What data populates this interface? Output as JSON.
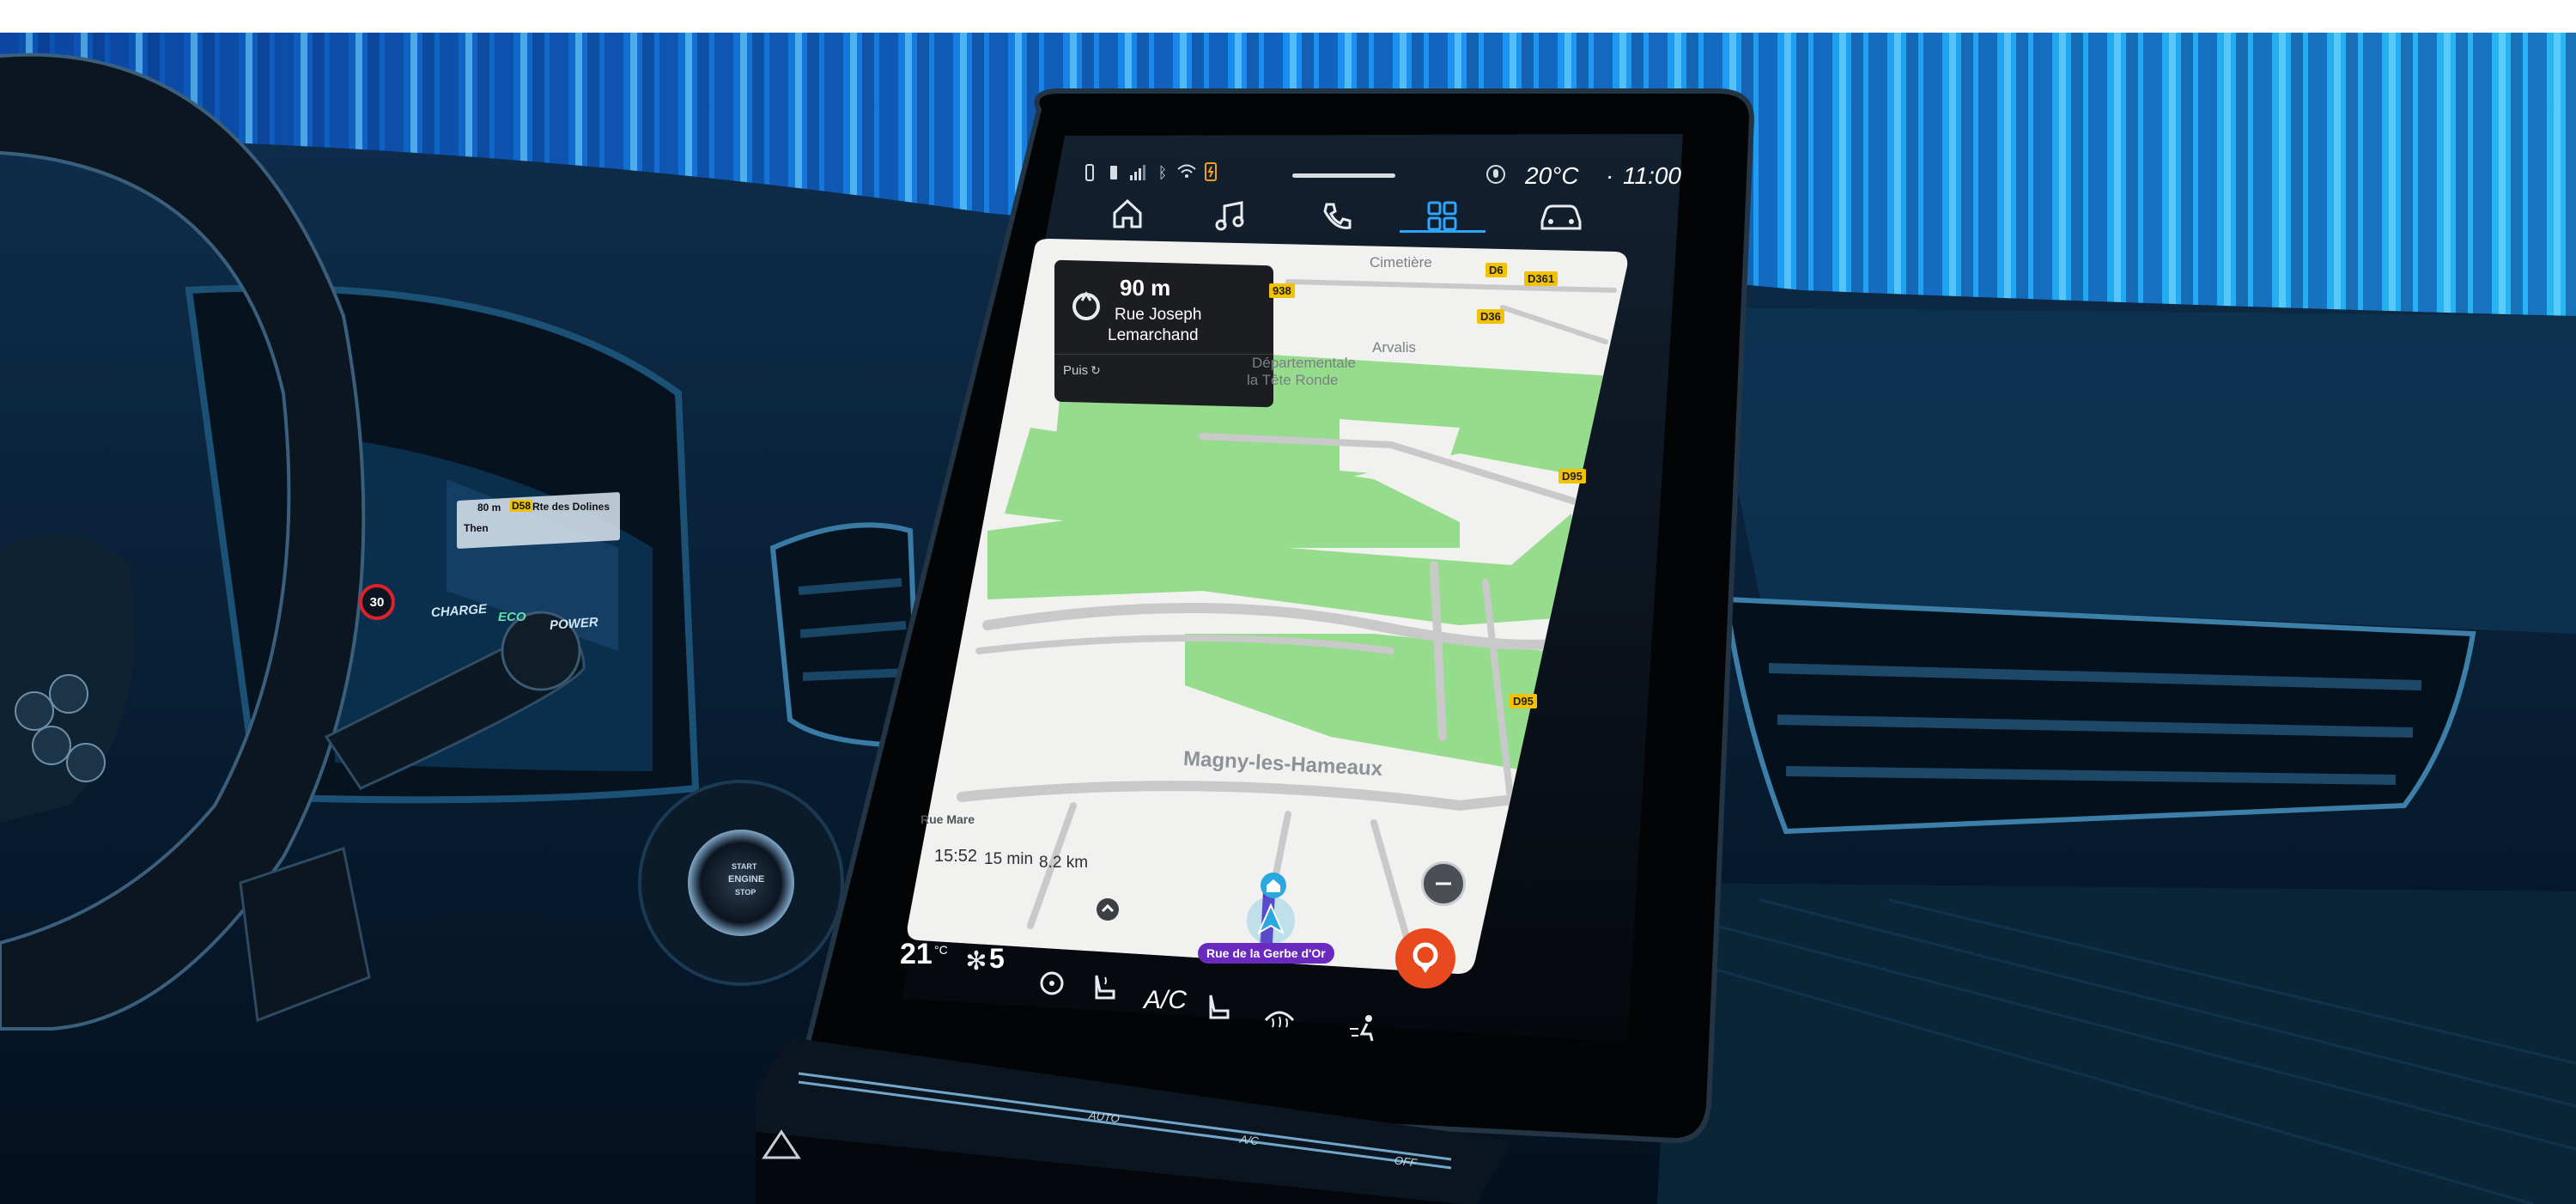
{
  "status_bar": {
    "temperature": "20°C",
    "separator": "·",
    "clock": "11:00",
    "icons": [
      "phone-signal-icon",
      "battery-icon",
      "signal-bars-icon",
      "bluetooth-icon",
      "wifi-icon",
      "phone-charge-icon",
      "mic-icon"
    ]
  },
  "top_nav": {
    "items": [
      {
        "name": "home",
        "icon": "home-icon"
      },
      {
        "name": "music",
        "icon": "music-note-icon"
      },
      {
        "name": "phone",
        "icon": "phone-icon"
      },
      {
        "name": "apps",
        "icon": "apps-grid-icon",
        "active": true
      },
      {
        "name": "vehicle",
        "icon": "car-icon"
      }
    ]
  },
  "navigation": {
    "turn_distance": "90 m",
    "street_line1": "Rue Joseph",
    "street_line2": "Lemarchand",
    "then_label": "Puis",
    "eta_time": "15:52",
    "eta_duration": "15 min",
    "eta_distance": "8.2 km",
    "current_road": "Rue de la Gerbe d'Or",
    "map_labels": {
      "town": "Magny-les-Hameaux",
      "place1": "Cimetière",
      "place2": "Arvalis",
      "place3": "Départementale",
      "place4": "la Tête Ronde",
      "place5": "Rue Mare"
    },
    "road_badges": [
      "D6",
      "D361",
      "D36",
      "D95",
      "D95",
      "938"
    ]
  },
  "climate_bar": {
    "temp_value": "21",
    "temp_unit": "°C",
    "fan_level": "5",
    "ac_label": "A/C"
  },
  "cluster": {
    "nav_hint_line1": "80 m",
    "nav_hint_road": "D58",
    "nav_hint_street": "Rte des Dolines",
    "nav_hint_then": "Then",
    "speed_limit": "30",
    "mode_charge": "CHARGE",
    "mode_eco": "ECO",
    "mode_power": "POWER"
  },
  "engine_button": {
    "line1": "START",
    "line2": "ENGINE",
    "line3": "STOP"
  },
  "hard_buttons": {
    "auto": "AUTO",
    "ac": "A/C",
    "off": "OFF"
  },
  "colors": {
    "map_green": "#95dc8c",
    "map_bg": "#f1f2ef",
    "nav_accent": "#6a2ac0",
    "locate_button": "#e8491f",
    "screen_dark": "#0b0f16",
    "bg_blue": "#1f8fe0"
  }
}
